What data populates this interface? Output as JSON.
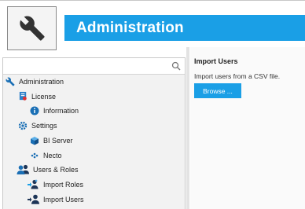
{
  "header": {
    "title": "Administration",
    "logo_icon": "wrench-icon"
  },
  "sidebar": {
    "search": {
      "value": "",
      "placeholder": ""
    },
    "tree": [
      {
        "label": "Administration",
        "icon": "wrench-icon"
      },
      {
        "label": "License",
        "icon": "license-icon"
      },
      {
        "label": "Information",
        "icon": "info-icon"
      },
      {
        "label": "Settings",
        "icon": "gear-icon"
      },
      {
        "label": "BI Server",
        "icon": "cube-icon"
      },
      {
        "label": "Necto",
        "icon": "necto-icon"
      },
      {
        "label": "Users & Roles",
        "icon": "users-icon"
      },
      {
        "label": "Import Roles",
        "icon": "import-roles-icon"
      },
      {
        "label": "Import Users",
        "icon": "import-users-icon"
      }
    ]
  },
  "main": {
    "title": "Import Users",
    "description": "Import users from a CSV file.",
    "browse_label": "Browse ..."
  },
  "colors": {
    "accent": "#1a9fe6",
    "tree_bg": "#f2f2f2",
    "icon_dark": "#1d3557"
  }
}
